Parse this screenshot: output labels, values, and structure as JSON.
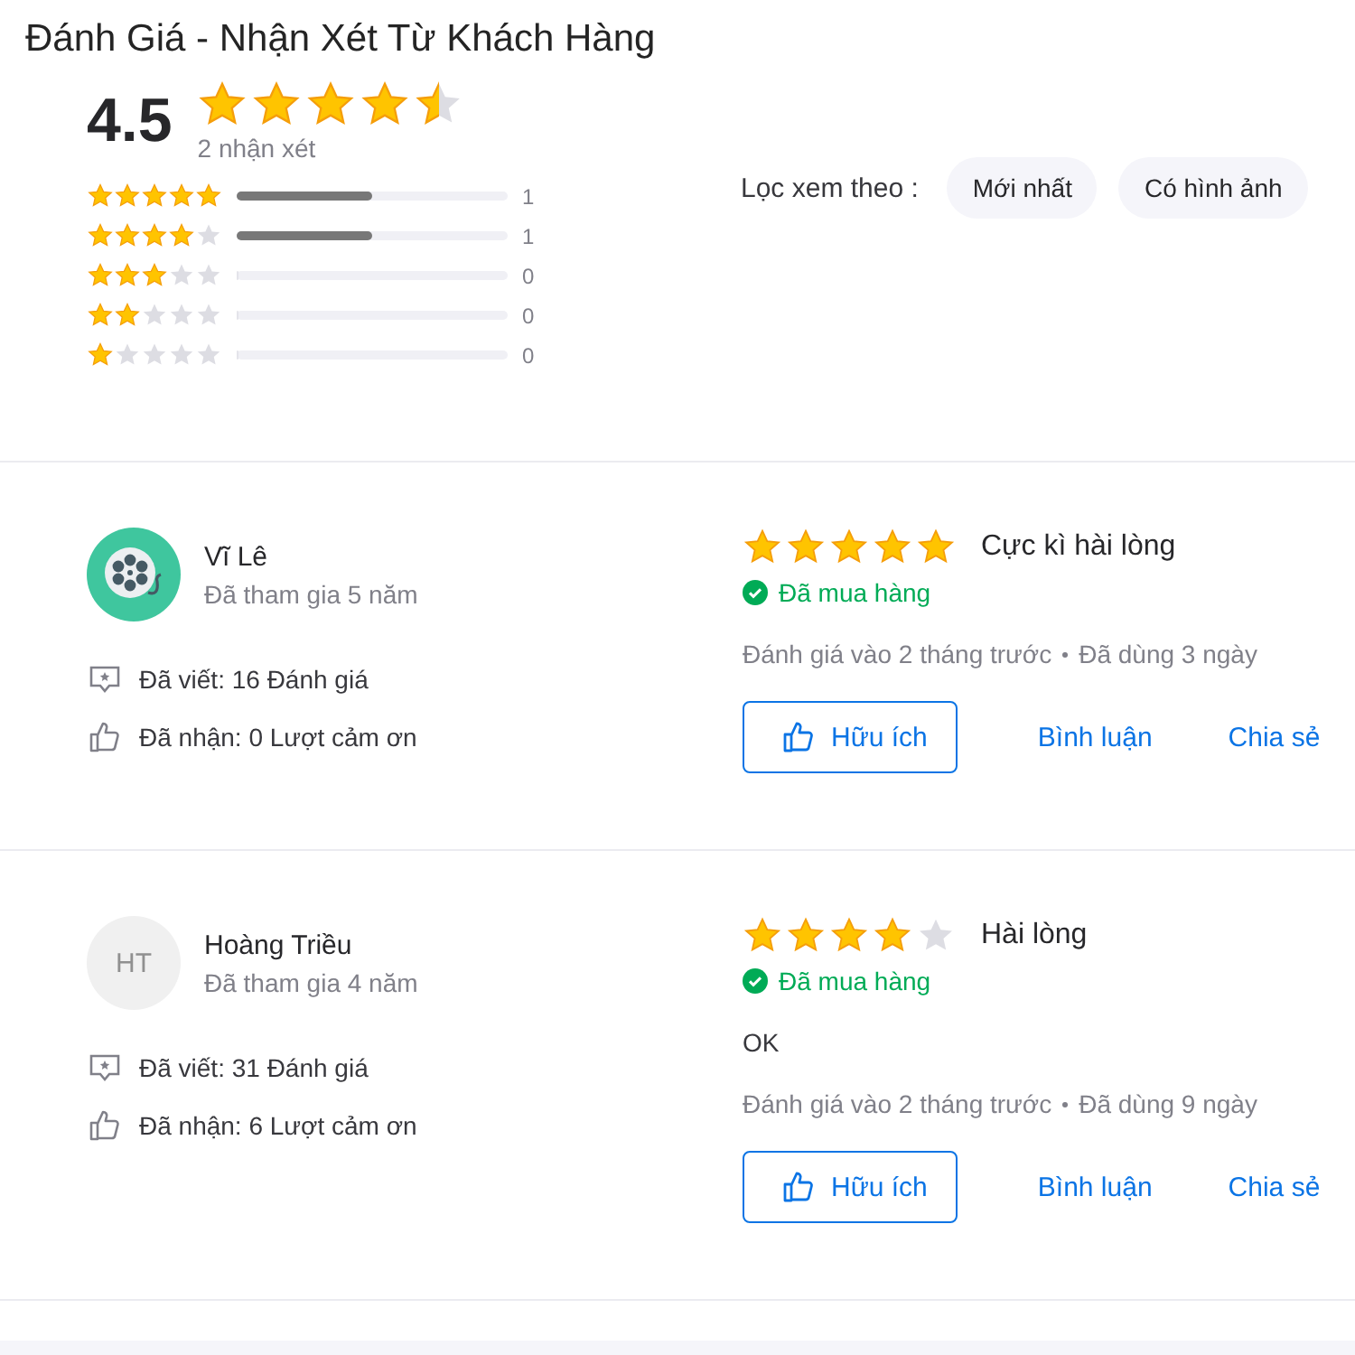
{
  "title": "Đánh Giá - Nhận Xét Từ Khách Hàng",
  "summary": {
    "score": "4.5",
    "stars": 4.5,
    "count": "2 nhận xét"
  },
  "histogram": [
    {
      "stars": 5,
      "level": 0.5,
      "count": "1"
    },
    {
      "stars": 4,
      "level": 0.5,
      "count": "1"
    },
    {
      "stars": 3,
      "level": 0,
      "count": "0"
    },
    {
      "stars": 2,
      "level": 0,
      "count": "0"
    },
    {
      "stars": 1,
      "level": 0,
      "count": "0"
    }
  ],
  "filter": {
    "label": "Lọc xem theo :",
    "chips": [
      {
        "label": "Mới nhất",
        "selected": false
      },
      {
        "label": "Có hình ảnh",
        "selected": false
      }
    ]
  },
  "reviews": [
    {
      "avatar": {
        "kind": "icon"
      },
      "name": "Vĩ Lê",
      "joined": "Đã tham gia 5 năm",
      "written": "Đã viết: 16 Đánh giá",
      "thanks": "Đã nhận: 0 Lượt cảm ơn",
      "stars": 5,
      "verdict": "Cực kì hài lòng",
      "purchased": "Đã mua hàng",
      "date": "Đánh giá vào 2 tháng trước",
      "used": "Đã dùng 3 ngày",
      "helpful": "Hữu ích",
      "comment_link": "Bình luận",
      "share": "Chia sẻ"
    },
    {
      "avatar": {
        "kind": "initials",
        "text": "HT"
      },
      "name": "Hoàng Triều",
      "joined": "Đã tham gia 4 năm",
      "written": "Đã viết: 31 Đánh giá",
      "thanks": "Đã nhận: 6 Lượt cảm ơn",
      "stars": 4,
      "verdict": "Hài lòng",
      "purchased": "Đã mua hàng",
      "content": "OK",
      "date": "Đánh giá vào 2 tháng trước",
      "used": "Đã dùng 9 ngày",
      "helpful": "Hữu ích",
      "comment_link": "Bình luận",
      "share": "Chia sẻ"
    }
  ]
}
